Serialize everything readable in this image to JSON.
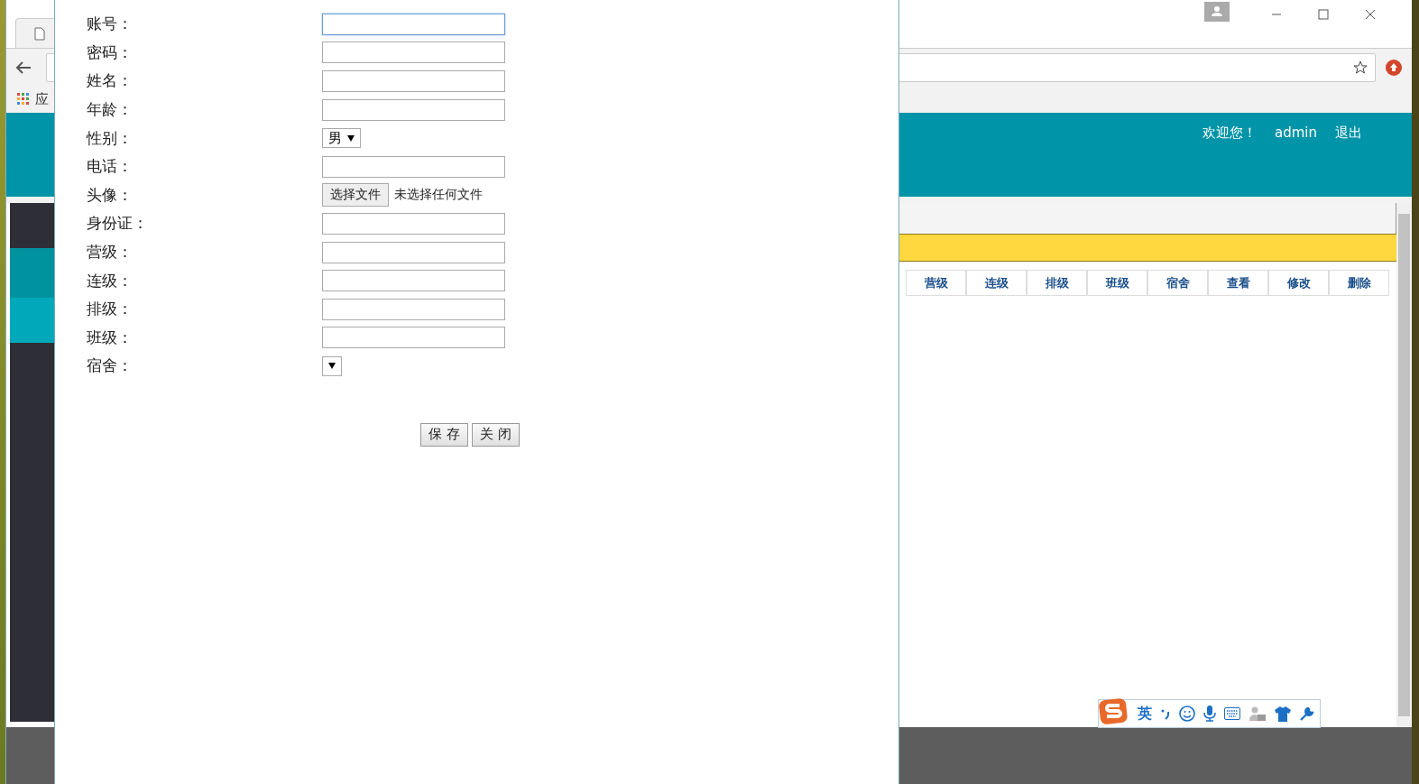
{
  "browser": {
    "bookmarks": [
      "应"
    ],
    "header": {
      "welcome": "欢迎您！",
      "user": "admin",
      "logout": "退出"
    },
    "table": {
      "columns": [
        "营级",
        "连级",
        "排级",
        "班级",
        "宿舍",
        "查看",
        "修改",
        "删除"
      ]
    }
  },
  "dialog": {
    "fields": [
      {
        "label": "账号：",
        "kind": "text",
        "focused": true
      },
      {
        "label": "密码：",
        "kind": "text",
        "focused": false
      },
      {
        "label": "姓名：",
        "kind": "text",
        "focused": false
      },
      {
        "label": "年龄：",
        "kind": "text",
        "focused": false
      },
      {
        "label": "性别：",
        "kind": "select",
        "value": "男"
      },
      {
        "label": "电话：",
        "kind": "text",
        "focused": false
      },
      {
        "label": "头像：",
        "kind": "file",
        "button": "选择文件",
        "status": "未选择任何文件"
      },
      {
        "label": "身份证：",
        "kind": "text",
        "focused": false
      },
      {
        "label": "营级：",
        "kind": "text",
        "focused": false
      },
      {
        "label": "连级：",
        "kind": "text",
        "focused": false
      },
      {
        "label": "排级：",
        "kind": "text",
        "focused": false
      },
      {
        "label": "班级：",
        "kind": "text",
        "focused": false
      },
      {
        "label": "宿舍：",
        "kind": "select"
      }
    ],
    "buttons": [
      "保 存",
      "关 闭"
    ]
  },
  "ime": {
    "mode": "英"
  }
}
